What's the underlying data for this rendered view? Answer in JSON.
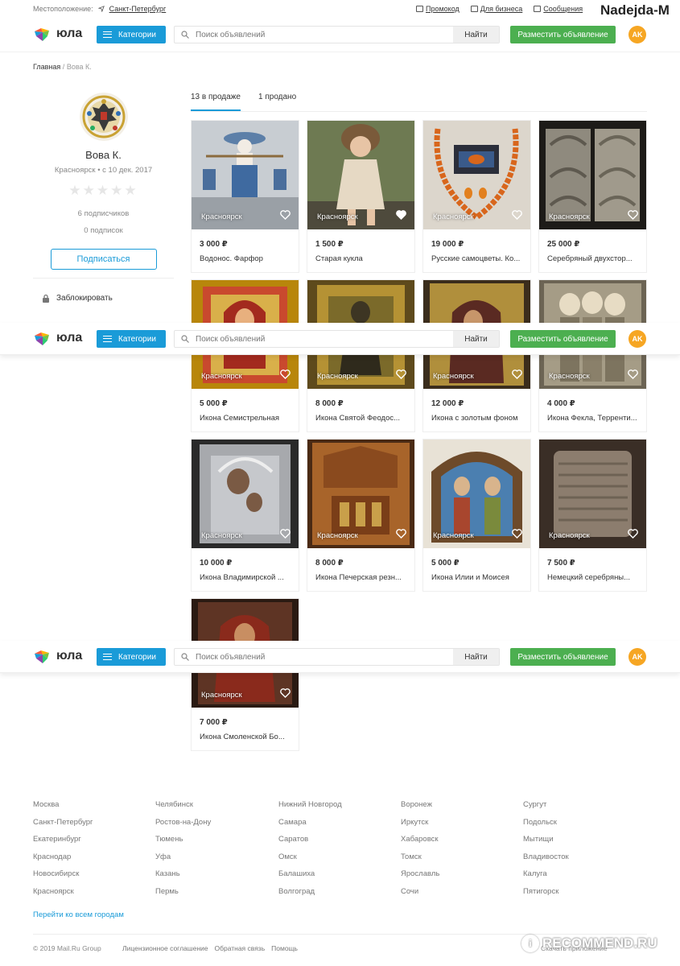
{
  "topbar": {
    "location_label": "Местоположение:",
    "location_city": "Санкт-Петербург",
    "links": [
      "Промокод",
      "Для бизнеса",
      "Сообщения"
    ],
    "username_watermark": "Nadejda-M"
  },
  "header": {
    "logo_text": "юла",
    "categories_label": "Категории",
    "search_placeholder": "Поиск объявлений",
    "find_label": "Найти",
    "post_label": "Разместить объявление",
    "avatar_initials": "AK",
    "colors": {
      "blue": "#1a9bd8",
      "green": "#4caf50",
      "avatar": "#f6a623"
    }
  },
  "breadcrumb": {
    "home": "Главная",
    "separator": "/",
    "current": "Вова К."
  },
  "profile": {
    "name": "Вова К.",
    "meta": "Красноярск • с 10 дек. 2017",
    "stars": "★★★★★",
    "rating_stars_filled": 0,
    "followers": "6 подписчиков",
    "following": "0 подписок",
    "subscribe_label": "Подписаться",
    "block_label": "Заблокировать"
  },
  "tabs": [
    {
      "label": "13 в продаже",
      "active": true
    },
    {
      "label": "1 продано",
      "active": false
    }
  ],
  "products": [
    {
      "city": "Красноярск",
      "price": "3 000 ₽",
      "title": "Водонос. Фарфор"
    },
    {
      "city": "Красноярск",
      "price": "1 500 ₽",
      "title": "Старая кукла",
      "liked": true
    },
    {
      "city": "Красноярск",
      "price": "19 000 ₽",
      "title": "Русские самоцветы. Ко..."
    },
    {
      "city": "Красноярск",
      "price": "25 000 ₽",
      "title": "Серебряный двухстор..."
    },
    {
      "city": "Красноярск",
      "price": "5 000 ₽",
      "title": "Икона Семистрельная"
    },
    {
      "city": "Красноярск",
      "price": "8 000 ₽",
      "title": "Икона Святой Феодос..."
    },
    {
      "city": "Красноярск",
      "price": "12 000 ₽",
      "title": "Икона с золотым фоном"
    },
    {
      "city": "Красноярск",
      "price": "4 000 ₽",
      "title": "Икона Фекла, Терренти..."
    },
    {
      "city": "Красноярск",
      "price": "10 000 ₽",
      "title": "Икона Владимирской ..."
    },
    {
      "city": "Красноярск",
      "price": "8 000 ₽",
      "title": "Икона Печерская резн..."
    },
    {
      "city": "Красноярск",
      "price": "5 000 ₽",
      "title": "Икона Илии и Моисея"
    },
    {
      "city": "Красноярск",
      "price": "7 500 ₽",
      "title": "Немецкий серебряны..."
    },
    {
      "city": "Красноярск",
      "price": "7 000 ₽",
      "title": "Икона Смоленской Бо..."
    }
  ],
  "footer": {
    "city_columns": [
      [
        "Москва",
        "Санкт-Петербург",
        "Екатеринбург",
        "Краснодар",
        "Новосибирск",
        "Красноярск"
      ],
      [
        "Челябинск",
        "Ростов-на-Дону",
        "Тюмень",
        "Уфа",
        "Казань",
        "Пермь"
      ],
      [
        "Нижний Новгород",
        "Самара",
        "Саратов",
        "Омск",
        "Балашиха",
        "Волгоград"
      ],
      [
        "Воронеж",
        "Иркутск",
        "Хабаровск",
        "Томск",
        "Ярославль",
        "Сочи"
      ],
      [
        "Сургут",
        "Подольск",
        "Мытищи",
        "Владивосток",
        "Калуга",
        "Пятигорск"
      ]
    ],
    "all_cities": "Перейти ко всем городам",
    "copyright": "© 2019 Mail.Ru Group",
    "links": [
      "Лицензионное соглашение",
      "Обратная связь",
      "Помощь"
    ],
    "app_label": "Скачать приложение",
    "watermark_site": "RECOMMEND.RU",
    "watermark_badge": "i"
  }
}
